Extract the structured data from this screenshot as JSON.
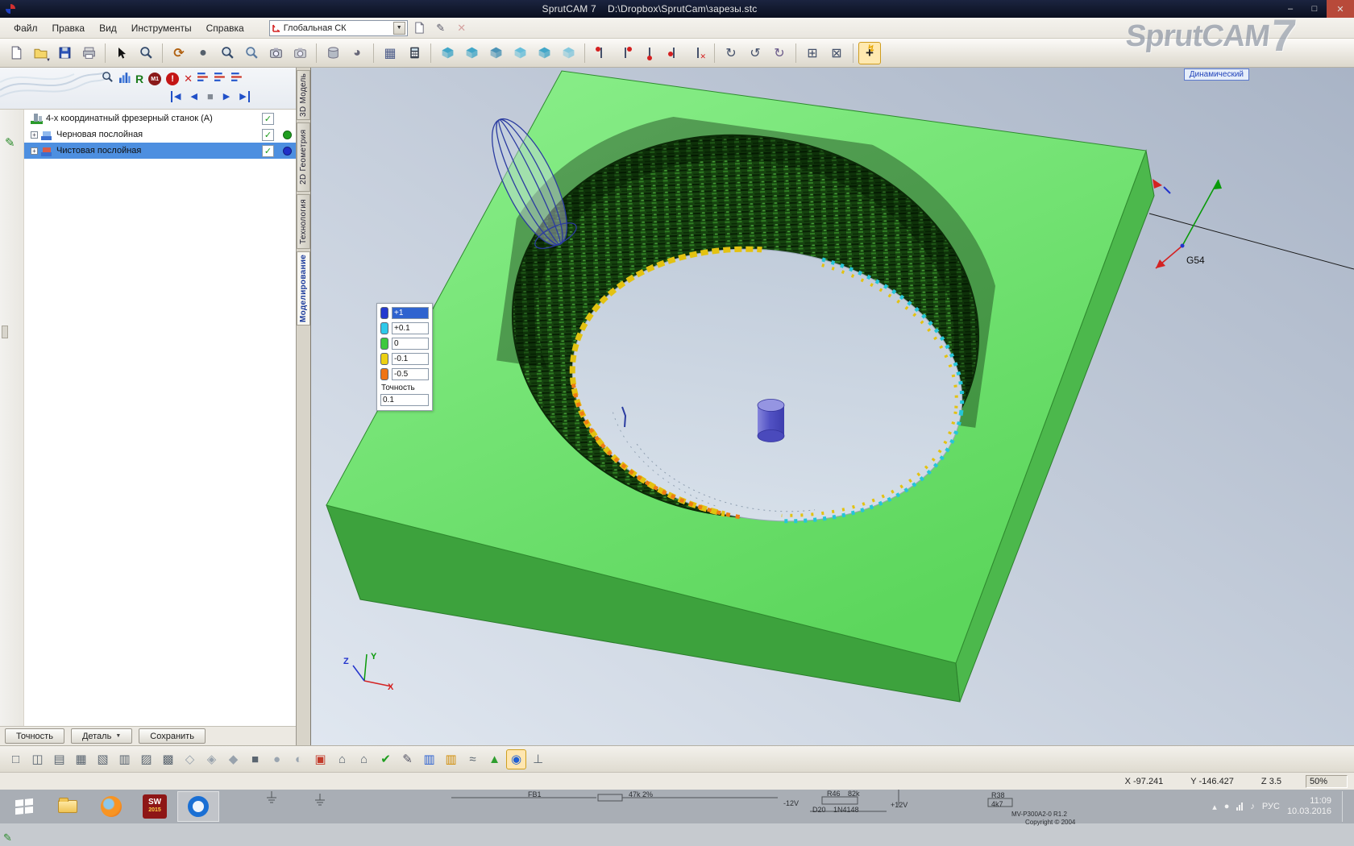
{
  "window": {
    "title": "SprutCAM 7    D:\\Dropbox\\SprutCam\\зарезы.stc",
    "minimize": "–",
    "maximize": "□",
    "close": "✕"
  },
  "menu": {
    "items": [
      "Файл",
      "Правка",
      "Вид",
      "Инструменты",
      "Справка"
    ],
    "cs_value": "Глобальная СК",
    "dropdown": "▼",
    "edit_icon": "✎",
    "close_icon": "✕"
  },
  "brand": {
    "name": "SprutCAM",
    "version": "7"
  },
  "toolbar": {
    "glyphs": {
      "rotate": "⟳",
      "sphere": "●",
      "orbit": "◕",
      "table": "▦",
      "rot_cw": "↻",
      "rot_ccw": "↺",
      "grid": "⊞",
      "merge": "⊠",
      "flash": "↯",
      "plus": "+",
      "snap_x": "✕",
      "open_arrow": "▼"
    }
  },
  "sidebar": {
    "r_label": "R",
    "m1_label": "M1",
    "warn_label": "!",
    "close_label": "✕",
    "check": "✓",
    "expand": "+",
    "tree": [
      {
        "label": "4-х координатный фрезерный станок (А)"
      },
      {
        "label": "Черновая послойная"
      },
      {
        "label": "Чистовая послойная"
      }
    ],
    "buttons": {
      "accuracy": "Точность",
      "detail": "Деталь",
      "save": "Сохранить"
    }
  },
  "playback": {
    "skip_start": "◀",
    "prev": "◀",
    "stop": "■",
    "play": "▶",
    "skip_end": "▶"
  },
  "tabs": [
    {
      "label": "3D Модель"
    },
    {
      "label": "2D Геометрия"
    },
    {
      "label": "Технология"
    },
    {
      "label": "Моделирование"
    }
  ],
  "viewport": {
    "mode": "Динамический",
    "wcs": "G54",
    "axis_x": "X",
    "axis_y": "Y",
    "axis_z": "Z",
    "legend": {
      "rows": [
        {
          "value": "+1",
          "color": "#2338cf"
        },
        {
          "value": "+0.1",
          "color": "#2ec9ea"
        },
        {
          "value": "0",
          "color": "#3dc93d"
        },
        {
          "value": "-0.1",
          "color": "#ecd012"
        },
        {
          "value": "-0.5",
          "color": "#f07414"
        }
      ],
      "accuracy_label": "Точность",
      "accuracy_value": "0.1"
    }
  },
  "simbar": {
    "glyphs": [
      "□",
      "◫",
      "▤",
      "▦",
      "▧",
      "▥",
      "▨",
      "▩",
      "◇",
      "◈",
      "◆",
      "■",
      "●",
      "◐",
      "▣",
      "⌂",
      "⌂",
      "✔",
      "✎",
      "▥",
      "▥",
      "≈",
      "▲",
      "◉",
      "⊥"
    ]
  },
  "statusbar": {
    "x": "X -97.241",
    "y": "Y -146.427",
    "z": "Z 3.5",
    "zoom": "50%"
  },
  "taskbar": {
    "language": "РУС",
    "time": "11:09",
    "date": "10.03.2016",
    "solidworks_label": "SW",
    "solidworks_year": "2015",
    "tray": [
      "▴",
      "●",
      "♪"
    ]
  },
  "schematic": {
    "f1": "FB1",
    "f2": "47k 2%",
    "f3": "-12V",
    "f4": "R46",
    "f5": "82k",
    "f6": "D20",
    "f7": "1N4148",
    "f8": "+12V",
    "f9": "R38",
    "f10": "4k7",
    "f11": "MV-P300A2-0 R1.2",
    "f12": "Copyright © 2004"
  }
}
